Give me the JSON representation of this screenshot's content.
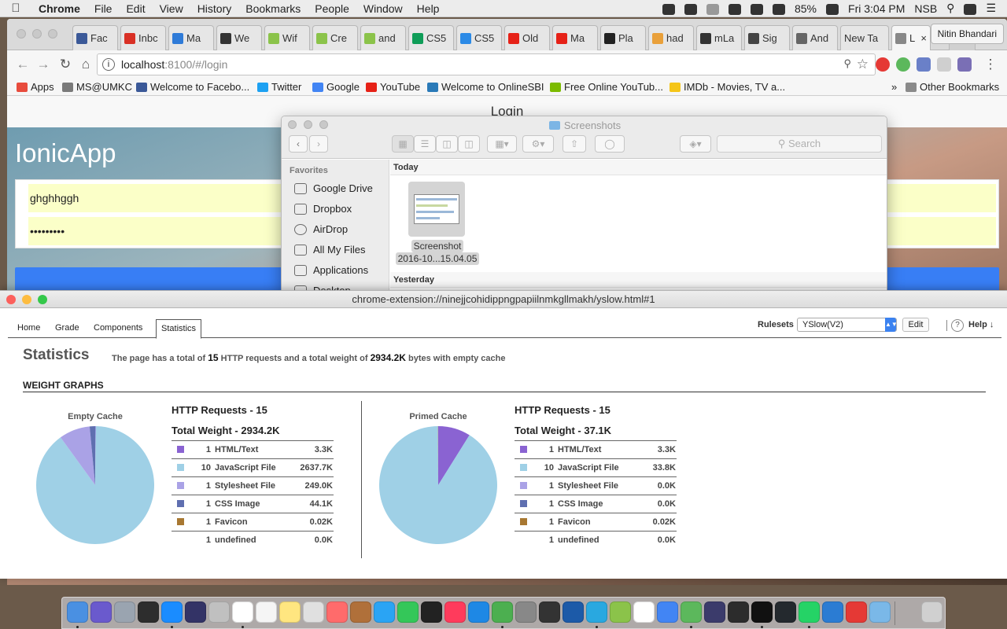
{
  "menubar": {
    "app_name": "Chrome",
    "menus": [
      "File",
      "Edit",
      "View",
      "History",
      "Bookmarks",
      "People",
      "Window",
      "Help"
    ],
    "battery": "85%",
    "clock": "Fri 3:04 PM",
    "user": "NSB"
  },
  "browser": {
    "tabs": [
      {
        "label": "Fac",
        "icon_color": "#3b5998"
      },
      {
        "label": "Inbc",
        "icon_color": "#d93025"
      },
      {
        "label": "Ma",
        "icon_color": "#2f7bd8"
      },
      {
        "label": "We",
        "icon_color": "#333333"
      },
      {
        "label": "Wif",
        "icon_color": "#8bc34a"
      },
      {
        "label": "Cre",
        "icon_color": "#8bc34a"
      },
      {
        "label": "and",
        "icon_color": "#8bc34a"
      },
      {
        "label": "CS5",
        "icon_color": "#0f9d58"
      },
      {
        "label": "CS5",
        "icon_color": "#2b8ae6"
      },
      {
        "label": "Old",
        "icon_color": "#e62117"
      },
      {
        "label": "Ma",
        "icon_color": "#e62117"
      },
      {
        "label": "Pla",
        "icon_color": "#222222"
      },
      {
        "label": "had",
        "icon_color": "#e9a03a"
      },
      {
        "label": "mLa",
        "icon_color": "#333333"
      },
      {
        "label": "Sig",
        "icon_color": "#444444"
      },
      {
        "label": "And",
        "icon_color": "#666666"
      },
      {
        "label": "New Ta",
        "icon_color": ""
      },
      {
        "label": "L",
        "icon_color": "#888888"
      }
    ],
    "profile_name": "Nitin Bhandari",
    "url_host": "localhost",
    "url_path": ":8100/#/login",
    "bookmarks": [
      {
        "label": "Apps",
        "icon_color": "#e84c3d"
      },
      {
        "label": "MS@UMKC",
        "icon_color": "#7a7a7a"
      },
      {
        "label": "Welcome to Facebo...",
        "icon_color": "#3b5998"
      },
      {
        "label": "Twitter",
        "icon_color": "#1da1f2"
      },
      {
        "label": "Google",
        "icon_color": "#4285f4"
      },
      {
        "label": "YouTube",
        "icon_color": "#e62117"
      },
      {
        "label": "Welcome to OnlineSBI",
        "icon_color": "#2a7ab8"
      },
      {
        "label": "Free Online YouTub...",
        "icon_color": "#7cbb00"
      },
      {
        "label": "IMDb - Movies, TV a...",
        "icon_color": "#f5c518"
      }
    ],
    "other_bookmarks": "Other Bookmarks"
  },
  "ionic": {
    "header_title": "Login",
    "app_title": "IonicApp",
    "username_value": "ghghhggh",
    "password_value": "•••••••••"
  },
  "finder": {
    "title": "Screenshots",
    "search_placeholder": "Search",
    "favorites_heading": "Favorites",
    "sidebar_items": [
      "Google Drive",
      "Dropbox",
      "AirDrop",
      "All My Files",
      "Applications",
      "Desktop"
    ],
    "today_label": "Today",
    "yesterday_label": "Yesterday",
    "file_name_line1": "Screenshot",
    "file_name_line2": "2016-10...15.04.05"
  },
  "yslow": {
    "window_title": "chrome-extension://ninejjcohidippngpapiilnmkgllmakh/yslow.html#1",
    "tabs": [
      "Home",
      "Grade",
      "Components",
      "Statistics"
    ],
    "active_tab": "Statistics",
    "rulesets_label": "Rulesets",
    "ruleset_value": "YSlow(V2)",
    "edit_label": "Edit",
    "help_label": "Help ↓",
    "stats_title": "Statistics",
    "summary_prefix": "The page has a total of",
    "summary_requests": "15",
    "summary_middle": "HTTP requests and a total weight of",
    "summary_weight": "2934.2K",
    "summary_suffix": "bytes with empty cache",
    "weight_heading": "WEIGHT GRAPHS",
    "empty_cache": {
      "label": "Empty Cache",
      "http_requests": "HTTP Requests - 15",
      "total_weight": "Total Weight - 2934.2K",
      "rows": [
        {
          "count": "1",
          "name": "HTML/Text",
          "size": "3.3K",
          "color": "#8a63d2"
        },
        {
          "count": "10",
          "name": "JavaScript File",
          "size": "2637.7K",
          "color": "#9fd0e6"
        },
        {
          "count": "1",
          "name": "Stylesheet File",
          "size": "249.0K",
          "color": "#aaa2e6"
        },
        {
          "count": "1",
          "name": "CSS Image",
          "size": "44.1K",
          "color": "#5f6fb0"
        },
        {
          "count": "1",
          "name": "Favicon",
          "size": "0.02K",
          "color": "#a87832"
        },
        {
          "count": "1",
          "name": "undefined",
          "size": "0.0K",
          "color": ""
        }
      ]
    },
    "primed_cache": {
      "label": "Primed Cache",
      "http_requests": "HTTP Requests - 15",
      "total_weight": "Total Weight - 37.1K",
      "rows": [
        {
          "count": "1",
          "name": "HTML/Text",
          "size": "3.3K",
          "color": "#8a63d2"
        },
        {
          "count": "10",
          "name": "JavaScript File",
          "size": "33.8K",
          "color": "#9fd0e6"
        },
        {
          "count": "1",
          "name": "Stylesheet File",
          "size": "0.0K",
          "color": "#aaa2e6"
        },
        {
          "count": "1",
          "name": "CSS Image",
          "size": "0.0K",
          "color": "#5f6fb0"
        },
        {
          "count": "1",
          "name": "Favicon",
          "size": "0.02K",
          "color": "#a87832"
        },
        {
          "count": "1",
          "name": "undefined",
          "size": "0.0K",
          "color": ""
        }
      ]
    }
  },
  "chart_data": [
    {
      "type": "pie",
      "title": "Empty Cache",
      "series": [
        {
          "values": [
            3.3,
            2637.7,
            249.0,
            44.1,
            0.02,
            0.0
          ]
        }
      ],
      "categories": [
        "HTML/Text",
        "JavaScript File",
        "Stylesheet File",
        "CSS Image",
        "Favicon",
        "undefined"
      ],
      "colors": [
        "#8a63d2",
        "#9fd0e6",
        "#aaa2e6",
        "#5f6fb0",
        "#a87832",
        "#cccccc"
      ]
    },
    {
      "type": "pie",
      "title": "Primed Cache",
      "series": [
        {
          "values": [
            3.3,
            33.8,
            0.0,
            0.0,
            0.02,
            0.0
          ]
        }
      ],
      "categories": [
        "HTML/Text",
        "JavaScript File",
        "Stylesheet File",
        "CSS Image",
        "Favicon",
        "undefined"
      ],
      "colors": [
        "#8a63d2",
        "#9fd0e6",
        "#aaa2e6",
        "#5f6fb0",
        "#a87832",
        "#cccccc"
      ]
    }
  ],
  "dock": {
    "icon_colors": [
      "#4a90e2",
      "#6a5acd",
      "#9aa4b0",
      "#2d2d2d",
      "#1a8cff",
      "#333366",
      "#c0c0c0",
      "#ffffff",
      "#f5f5f5",
      "#ffe680",
      "#e0e0e0",
      "#ff6b6b",
      "#b0703a",
      "#2aa4f4",
      "#34c759",
      "#222222",
      "#ff3b5c",
      "#1e88e5",
      "#4caf50",
      "#888888",
      "#333333",
      "#1c5aa8",
      "#29a8e0",
      "#8bc34a",
      "#ffffff",
      "#4285f4",
      "#5cb85c",
      "#3b3b6b",
      "#2c2c2c",
      "#111111",
      "#24292e",
      "#25d366",
      "#2b7cd3",
      "#e53935",
      "#7ab8e8",
      "#d0d0d0"
    ]
  }
}
